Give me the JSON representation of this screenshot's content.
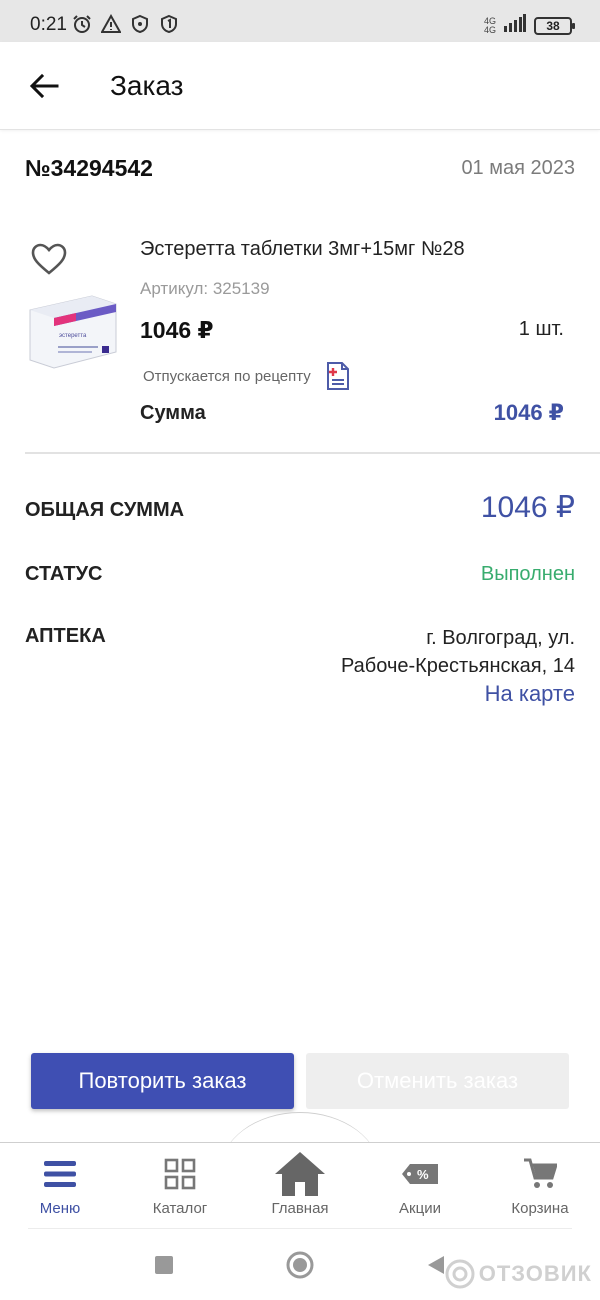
{
  "status_bar": {
    "time": "0:21",
    "network_top": "4G",
    "network_bottom": "4G",
    "battery": "38"
  },
  "header": {
    "title": "Заказ"
  },
  "order": {
    "number": "№34294542",
    "date": "01 мая 2023"
  },
  "product": {
    "name": "Эстеретта таблетки 3мг+15мг №28",
    "article": "Артикул: 325139",
    "price": "1046 ₽",
    "quantity": "1 шт.",
    "prescription_note": "Отпускается по рецепту",
    "sum_label": "Сумма",
    "sum_value": "1046 ₽",
    "box_brand": "эстеретта"
  },
  "summary": {
    "total_label": "ОБЩАЯ СУММА",
    "total_value": "1046 ₽",
    "status_label": "СТАТУС",
    "status_value": "Выполнен",
    "pharmacy_label": "АПТЕКА",
    "pharmacy_address_line1": "г. Волгоград, ул.",
    "pharmacy_address_line2": "Рабоче-Крестьянская, 14",
    "map_link": "На карте"
  },
  "actions": {
    "repeat": "Повторить заказ",
    "cancel": "Отменить заказ"
  },
  "bottom_nav": {
    "items": [
      {
        "label": "Меню",
        "icon": "menu-icon",
        "active": true
      },
      {
        "label": "Каталог",
        "icon": "catalog-grid-icon"
      },
      {
        "label": "Главная",
        "icon": "home-icon"
      },
      {
        "label": "Акции",
        "icon": "discount-tag-icon"
      },
      {
        "label": "Корзина",
        "icon": "cart-icon"
      }
    ]
  },
  "watermark": "ОТЗОВИК",
  "colors": {
    "accent": "#3f51a4",
    "button": "#3f4fb3",
    "status_done": "#38ac6e"
  }
}
